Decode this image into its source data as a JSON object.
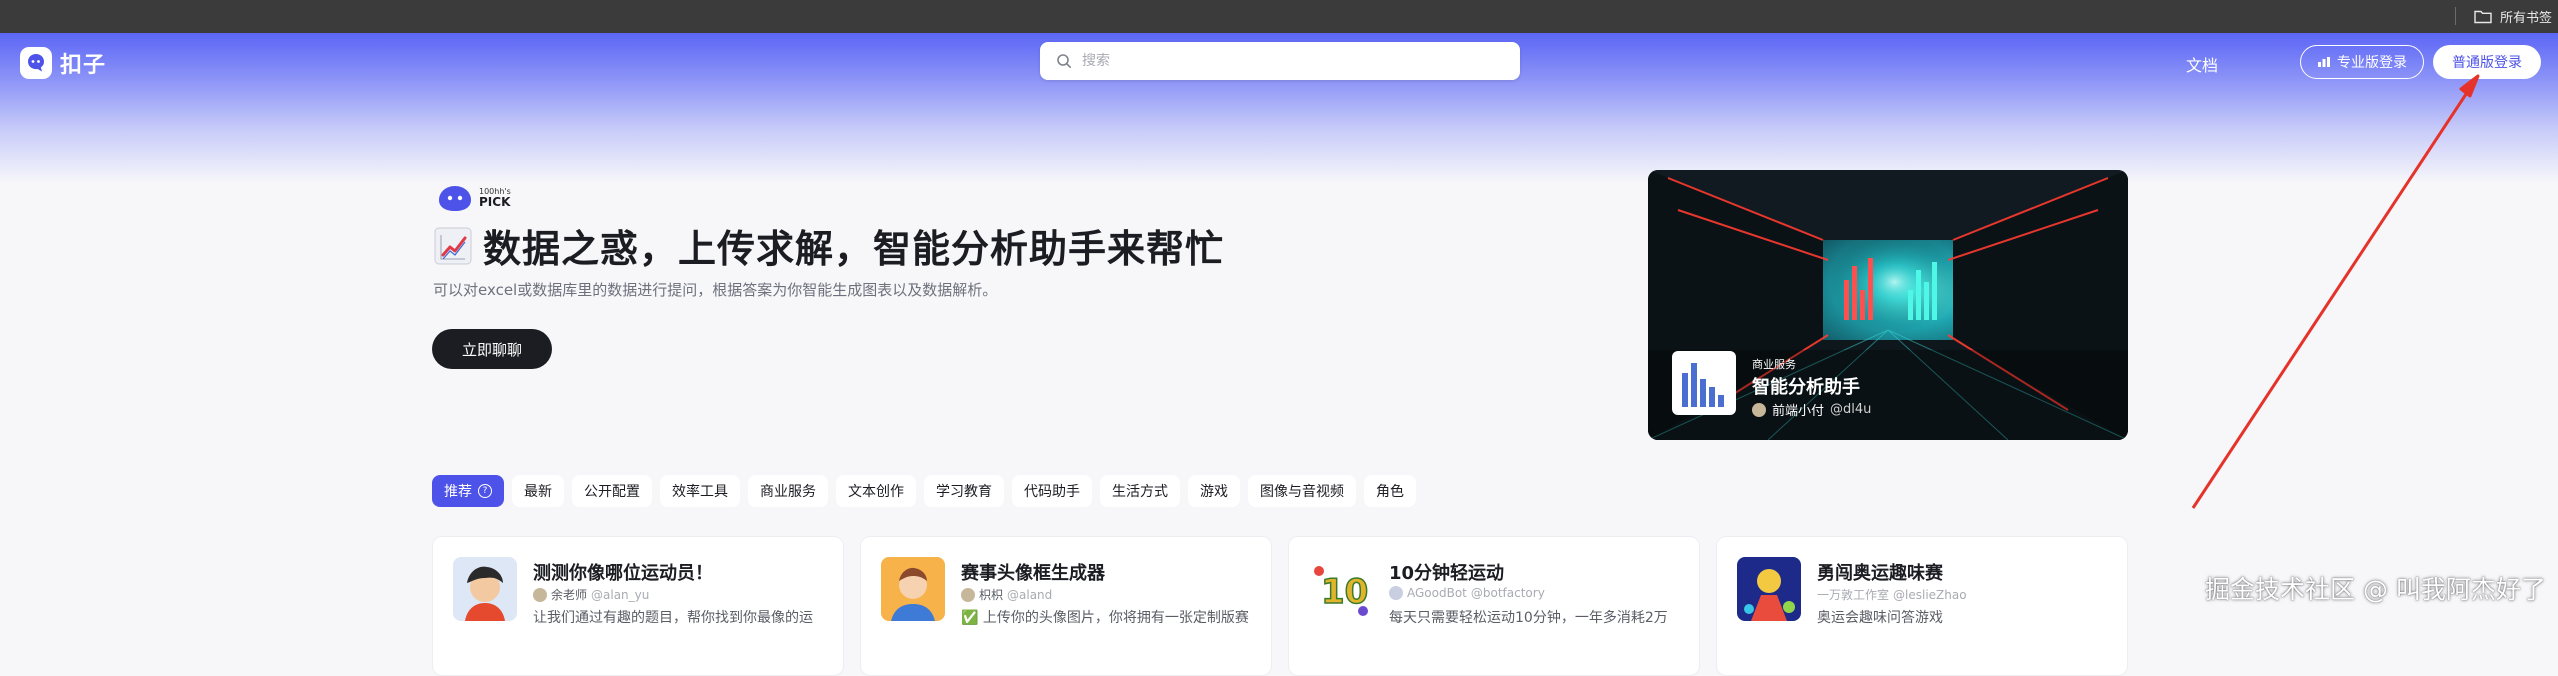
{
  "browser": {
    "bookmarks_label": "所有书签",
    "icon": "folder-icon"
  },
  "app": {
    "logo_text": "扣子",
    "search": {
      "placeholder": "搜索",
      "value": ""
    },
    "nav": {
      "doc_label": "文档",
      "pro_login_label": "专业版登录",
      "normal_login_label": "普通版登录"
    },
    "accent_color": "#4d53e8"
  },
  "hero": {
    "badge_small": "100hh's",
    "badge_big": "PICK",
    "title": "数据之惑，上传求解，智能分析助手来帮忙",
    "title_icon": "chart-increasing-icon",
    "description": "可以对excel或数据库里的数据进行提问，根据答案为你智能生成图表以及数据解析。",
    "cta_label": "立即聊聊"
  },
  "featured": {
    "tag": "商业服务",
    "title": "智能分析助手",
    "author": "前端小付",
    "handle": "@dl4u"
  },
  "categories": [
    {
      "label": "推荐",
      "active": true
    },
    {
      "label": "最新"
    },
    {
      "label": "公开配置"
    },
    {
      "label": "效率工具"
    },
    {
      "label": "商业服务"
    },
    {
      "label": "文本创作"
    },
    {
      "label": "学习教育"
    },
    {
      "label": "代码助手"
    },
    {
      "label": "生活方式"
    },
    {
      "label": "游戏"
    },
    {
      "label": "图像与音视频"
    },
    {
      "label": "角色"
    }
  ],
  "cards": [
    {
      "title": "测测你像哪位运动员！",
      "author": "余老师",
      "handle": "@alan_yu",
      "desc": "让我们通过有趣的题目，帮你找到你最像的运"
    },
    {
      "title": "赛事头像框生成器",
      "author": "枳枳",
      "handle": "@aland",
      "desc": "上传你的头像图片，你将拥有一张定制版赛"
    },
    {
      "title": "10分钟轻运动",
      "author": "AGoodBot",
      "handle": "@botfactory",
      "desc": "每天只需要轻松运动10分钟，一年多消耗2万"
    },
    {
      "title": "勇闯奥运趣味赛",
      "author": "一万敦工作室",
      "handle": "@leslieZhao",
      "desc": "奥运会趣味问答游戏"
    }
  ],
  "watermark": "掘金技术社区 @ 叫我阿杰好了"
}
